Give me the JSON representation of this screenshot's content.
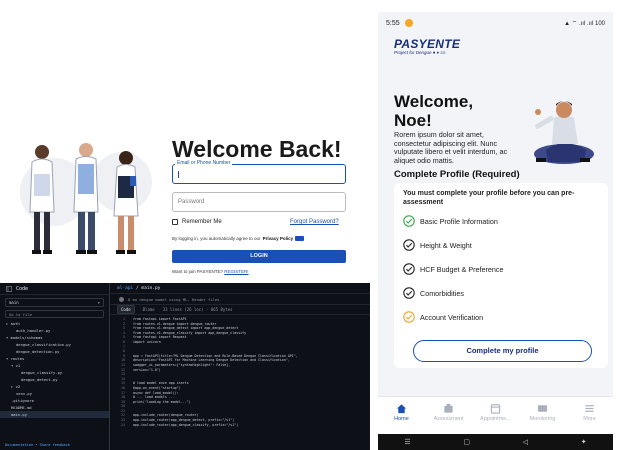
{
  "login": {
    "title": "Welcome Back!",
    "email_label": "Email or Phone Number",
    "password_placeholder": "Password",
    "remember_label": "Remember Me",
    "forgot_label": "Forgot Password?",
    "agree_prefix": "By logging in, you automatically agree to our",
    "privacy_label": "Privacy Policy",
    "login_label": "LOGIN",
    "join_prefix": "Want to join PASYENTE?",
    "register_label": "REGISTER!"
  },
  "code": {
    "sidebar_title": "Code",
    "branch": "main",
    "goto_file": "Go to file",
    "tree": [
      {
        "label": "▸ auth",
        "indent": 0
      },
      {
        "label": "auth_handler.py",
        "indent": 2
      },
      {
        "label": "▾ models/schemas",
        "indent": 0
      },
      {
        "label": "dengue_classification.py",
        "indent": 2
      },
      {
        "label": "dengue_detection.py",
        "indent": 2
      },
      {
        "label": "▾ routes",
        "indent": 0
      },
      {
        "label": "▾ v1",
        "indent": 1
      },
      {
        "label": "dengue_classify.py",
        "indent": 3
      },
      {
        "label": "dengue_detect.py",
        "indent": 3
      },
      {
        "label": "▸ v2",
        "indent": 1
      },
      {
        "label": "venv.py",
        "indent": 2
      },
      {
        "label": ".gitignore",
        "indent": 1
      },
      {
        "label": "README.md",
        "indent": 1
      },
      {
        "label": "main.py",
        "indent": 1
      }
    ],
    "tree_footer": "Documentation • Share feedback",
    "breadcrumb_repo": "ml-api",
    "breadcrumb_file": "/ main.py",
    "commit_text": "8 mo   dengue model using ML, Render files",
    "tab_code": "Code",
    "tab_blame": "Blame",
    "tab_meta": "33 lines (26 loc) · 865 Bytes",
    "lines": [
      "from fastapi import FastAPI",
      "from routes.v1.dengue import dengue_router",
      "from routes.v1.dengue_detect import app_dengue_detect",
      "from routes.v1.dengue_classify import app_dengue_classify",
      "from fastapi import Request",
      "import uvicorn",
      "",
      "",
      "app = FastAPI(title=\"ML Dengue Detection and Rule-Based Dengue Classification API\",",
      "    description=\"FastAPI for Machine Learning Dengue Detection and Classification\",",
      "    swagger_ui_parameters={\"syntaxHighlight\": False},",
      "    version=\"1.0\")",
      "",
      "",
      "# load model once app starts",
      "@app.on_event(\"startup\")",
      "async def load_model():",
      "    # ... load models ...",
      "    print(\"loading the model...\")",
      "",
      "",
      "app.include_router(dengue_router)",
      "app.include_router(app_dengue_detect, prefix=\"/v1\")",
      "app.include_router(app_dengue_classify, prefix=\"/v1\")"
    ]
  },
  "phone": {
    "time": "5:55",
    "status_right": "▲ ⌔ .ııl .ııl 100",
    "brand": "PASYENTE",
    "brand_sub": "Project for Dengue ● ♦ ≡≡",
    "welcome_line1": "Welcome,",
    "welcome_line2": "Noe!",
    "lorem": "Rorem ipsum dolor sit amet, consectetur adipiscing elit. Nunc vulputate libero et velit interdum, ac aliquet odio mattis.",
    "section_title": "Complete Profile (Required)",
    "card_desc": "You must complete your profile before you can pre-assessment",
    "steps": [
      {
        "label": "Basic Profile Information",
        "status": "done-green"
      },
      {
        "label": "Height & Weight",
        "status": "done-dark"
      },
      {
        "label": "HCF Budget & Preference",
        "status": "done-dark"
      },
      {
        "label": "Comorbidities",
        "status": "done-dark"
      },
      {
        "label": "Account Verification",
        "status": "done-orange"
      }
    ],
    "button": "Complete my profile",
    "nav": [
      "Home",
      "Assessment",
      "Appointme...",
      "Monitoring",
      "More"
    ],
    "colors": {
      "accent": "#1a4fb5",
      "brand": "#1a2e7a",
      "green": "#3aa84a",
      "orange": "#f0a32a"
    }
  }
}
